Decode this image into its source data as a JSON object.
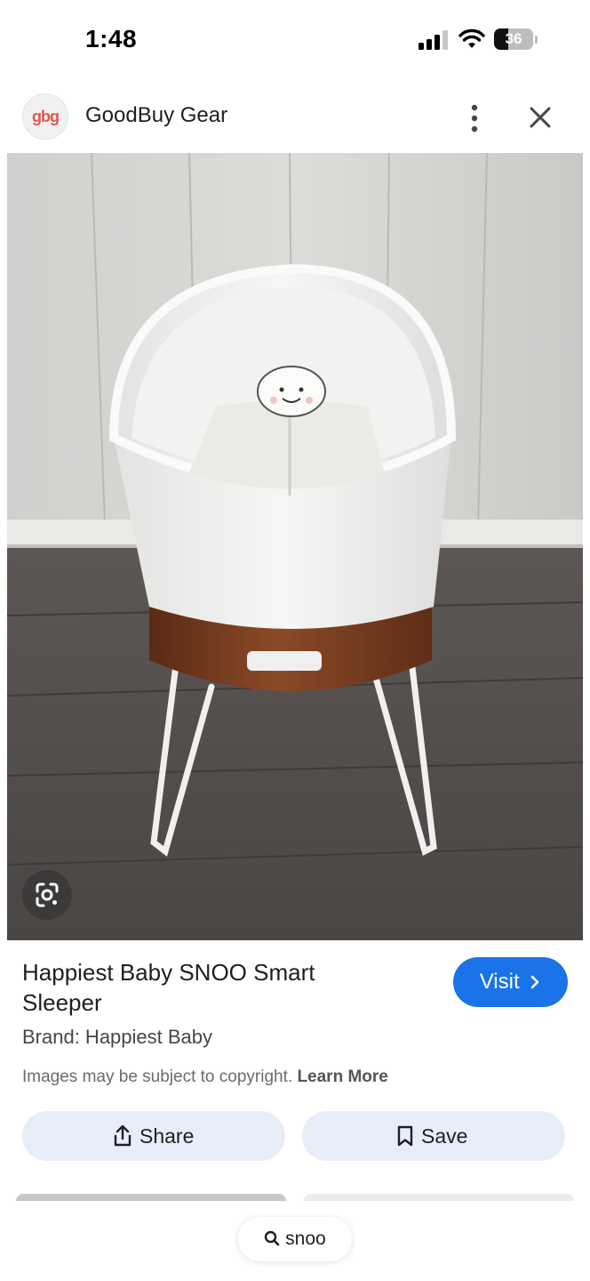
{
  "status_bar": {
    "time": "1:48",
    "battery_level": "36"
  },
  "source": {
    "logo_text": "gbg",
    "name": "GoodBuy Gear"
  },
  "result": {
    "title": "Happiest Baby SNOO Smart Sleeper",
    "brand": "Brand: Happiest Baby",
    "visit_label": "Visit",
    "copyright_text": "Images may be subject to copyright.",
    "learn_more": "Learn More"
  },
  "actions": {
    "share_label": "Share",
    "save_label": "Save"
  },
  "search": {
    "query": "snoo"
  },
  "colors": {
    "accent": "#1a73e8",
    "action_bg": "#e8eef9"
  },
  "icons": {
    "more": "more-vert-icon",
    "close": "close-icon",
    "lens": "lens-icon",
    "share": "share-icon",
    "save": "bookmark-icon",
    "search": "search-icon",
    "visit_arrow": "chevron-right-icon"
  }
}
